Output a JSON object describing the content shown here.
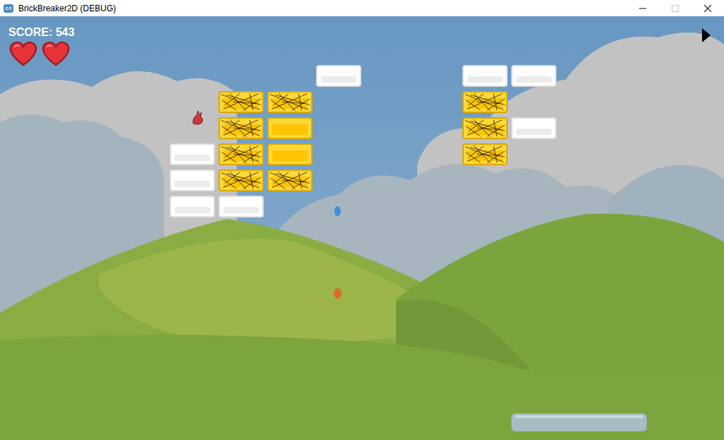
{
  "window": {
    "title": "BrickBreaker2D (DEBUG)",
    "controls": [
      {
        "kind": "minimize",
        "disabled": false
      },
      {
        "kind": "maximize",
        "disabled": true
      },
      {
        "kind": "close",
        "disabled": false
      }
    ]
  },
  "hud": {
    "score": "SCORE: 543",
    "lives": [
      {
        "full": true
      },
      {
        "full": true
      }
    ]
  },
  "bricks": {
    "rows": [
      [
        {
          "kind": "empty",
          "cracked": false
        },
        {
          "kind": "empty",
          "cracked": false
        },
        {
          "kind": "empty",
          "cracked": false
        },
        {
          "kind": "white",
          "cracked": false
        },
        {
          "kind": "empty",
          "cracked": false
        },
        {
          "kind": "empty",
          "cracked": false
        },
        {
          "kind": "white",
          "cracked": false
        },
        {
          "kind": "white",
          "cracked": false
        }
      ],
      [
        {
          "kind": "empty",
          "cracked": false
        },
        {
          "kind": "gold",
          "cracked": true
        },
        {
          "kind": "gold",
          "cracked": true
        },
        {
          "kind": "empty",
          "cracked": false
        },
        {
          "kind": "empty",
          "cracked": false
        },
        {
          "kind": "empty",
          "cracked": false
        },
        {
          "kind": "gold",
          "cracked": true
        },
        {
          "kind": "empty",
          "cracked": false
        }
      ],
      [
        {
          "kind": "empty",
          "cracked": false
        },
        {
          "kind": "gold",
          "cracked": true
        },
        {
          "kind": "gold",
          "cracked": false
        },
        {
          "kind": "empty",
          "cracked": false
        },
        {
          "kind": "empty",
          "cracked": false
        },
        {
          "kind": "empty",
          "cracked": false
        },
        {
          "kind": "gold",
          "cracked": true
        },
        {
          "kind": "white",
          "cracked": false
        }
      ],
      [
        {
          "kind": "white",
          "cracked": false
        },
        {
          "kind": "gold",
          "cracked": true
        },
        {
          "kind": "gold",
          "cracked": false
        },
        {
          "kind": "empty",
          "cracked": false
        },
        {
          "kind": "empty",
          "cracked": false
        },
        {
          "kind": "empty",
          "cracked": false
        },
        {
          "kind": "gold",
          "cracked": true
        },
        {
          "kind": "empty",
          "cracked": false
        }
      ],
      [
        {
          "kind": "white",
          "cracked": false
        },
        {
          "kind": "gold",
          "cracked": true
        },
        {
          "kind": "gold",
          "cracked": true
        },
        {
          "kind": "empty",
          "cracked": false
        },
        {
          "kind": "empty",
          "cracked": false
        },
        {
          "kind": "empty",
          "cracked": false
        },
        {
          "kind": "empty",
          "cracked": false
        },
        {
          "kind": "empty",
          "cracked": false
        }
      ],
      [
        {
          "kind": "white",
          "cracked": false
        },
        {
          "kind": "white",
          "cracked": false
        },
        {
          "kind": "empty",
          "cracked": false
        },
        {
          "kind": "empty",
          "cracked": false
        },
        {
          "kind": "empty",
          "cracked": false
        },
        {
          "kind": "empty",
          "cracked": false
        },
        {
          "kind": "empty",
          "cracked": false
        },
        {
          "kind": "empty",
          "cracked": false
        }
      ]
    ]
  },
  "balls": [
    {
      "color": "#3d8fdc"
    },
    {
      "color": "#e0692c"
    }
  ]
}
